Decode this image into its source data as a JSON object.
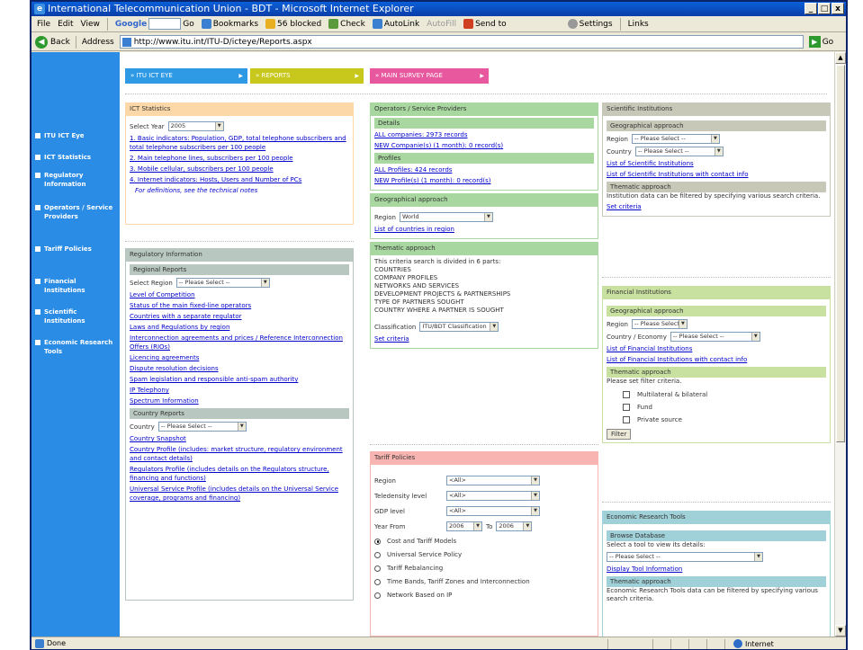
{
  "window": {
    "title": "International Telecommunication Union - BDT - Microsoft Internet Explorer",
    "controls": [
      "_",
      "□",
      "x"
    ]
  },
  "menubar": {
    "items": [
      "File",
      "Edit",
      "View"
    ],
    "google": "Google",
    "go": "Go",
    "bookmarks": "Bookmarks",
    "blocked": "56 blocked",
    "check": "Check",
    "autolink": "AutoLink",
    "autofill": "AutoFill",
    "sendto": "Send to",
    "settings": "Settings",
    "links": "Links"
  },
  "addressbar": {
    "back": "Back",
    "label": "Address",
    "url": "http://www.itu.int/ITU-D/icteye/Reports.aspx",
    "go": "Go"
  },
  "leftnav": [
    "ITU ICT Eye",
    "ICT Statistics",
    "Regulatory Information",
    "Operators / Service Providers",
    "Tariff Policies",
    "Financial Institutions",
    "Scientific Institutions",
    "Economic Research Tools"
  ],
  "tabs": [
    {
      "label": "» ITU ICT EYE",
      "color": "#2e9ae6"
    },
    {
      "label": "» REPORTS",
      "color": "#c8c81c"
    },
    {
      "label": "» MAIN SURVEY PAGE",
      "color": "#e8589e"
    }
  ],
  "ict": {
    "title": "ICT Statistics",
    "select_year_label": "Select Year",
    "year": "2005",
    "links": [
      "1. Basic indicators: Population, GDP, total telephone subscribers and total telephone subscribers per 100 people",
      "2. Main telephone lines, subscribers per 100 people",
      "3. Mobile cellular, subscribers per 100 people",
      "4. Internet indicators: Hosts, Users and Number of PCs"
    ],
    "note": "For definitions, see the technical notes"
  },
  "reg": {
    "title": "Regulatory Information",
    "regional_title": "Regional Reports",
    "select_region_label": "Select Region",
    "region_placeholder": "-- Please Select --",
    "links": [
      "Level of Competition",
      "Status of the main fixed-line operators",
      "Countries with a separate regulator",
      "Laws and Regulations by region",
      "Interconnection agreements and prices / Reference Interconnection Offers (RIOs)",
      "Licencing agreements",
      "Dispute resolution decisions",
      "Spam legislation and responsible anti-spam authority",
      "IP Telephony",
      "Spectrum Information"
    ],
    "country_title": "Country Reports",
    "country_label": "Country",
    "country_placeholder": "-- Please Select --",
    "country_links": [
      "Country Snapshot",
      "Country Profile (includes: market structure, regulatory environment and contact details)",
      "Regulators Profile (includes details on the Regulators structure, financing and functions)",
      "Universal Service Profile (includes details on the Universal Service coverage, programs and financing)"
    ]
  },
  "ops": {
    "title": "Operators / Service Providers",
    "details_title": "Details",
    "details_links": [
      "ALL companies: 2973 records",
      "NEW Companie(s) (1 month): 0 record(s)"
    ],
    "profiles_title": "Profiles",
    "profiles_links": [
      "ALL Profiles: 424 records",
      "NEW Profile(s) (1 month): 0 record(s)"
    ],
    "geo_title": "Geographical approach",
    "region_label": "Region",
    "region_value": "World",
    "countries_link": "List of countries in region",
    "thematic_title": "Thematic approach",
    "thematic_intro": "This criteria search is divided in 6 parts:",
    "parts": [
      "COUNTRIES",
      "COMPANY PROFILES",
      "NETWORKS AND SERVICES",
      "DEVELOPMENT PROJECTS & PARTNERSHIPS",
      "TYPE OF PARTNERS SOUGHT",
      "COUNTRY WHERE A PARTNER IS SOUGHT"
    ],
    "classification_label": "Classification",
    "classification_value": "ITU/BDT Classification",
    "set_criteria": "Set criteria"
  },
  "tariff": {
    "title": "Tariff Policies",
    "fields": [
      {
        "label": "Region",
        "value": "<All>"
      },
      {
        "label": "Teledensity level",
        "value": "<All>"
      },
      {
        "label": "GDP level",
        "value": "<All>"
      }
    ],
    "year_from_label": "Year From",
    "year_from": "2006",
    "to_label": "To",
    "year_to": "2006",
    "options": [
      "Cost and Tariff Models",
      "Universal Service Policy",
      "Tariff Rebalancing",
      "Time Bands, Tariff Zones and Interconnection",
      "Network Based on IP"
    ],
    "selected_option": "Cost and Tariff Models"
  },
  "sci": {
    "title": "Scientific Institutions",
    "geo_title": "Geographical approach",
    "region_label": "Region",
    "region_placeholder": "-- Please Select --",
    "country_label": "Country",
    "country_placeholder": "-- Please Select --",
    "links": [
      "List of Scientific Institutions",
      "List of Scientific Institutions with contact info"
    ],
    "thematic_title": "Thematic approach",
    "thematic_text": "Institution data can be filtered by specifying various search criteria.",
    "set_criteria": "Set criteria"
  },
  "fin": {
    "title": "Financial Institutions",
    "geo_title": "Geographical approach",
    "region_label": "Region",
    "region_placeholder": "-- Please Select --",
    "country_label": "Country / Economy",
    "country_placeholder": "-- Please Select --",
    "links": [
      "List of Financial Institutions",
      "List of Financial Institutions with contact info"
    ],
    "thematic_title": "Thematic approach",
    "thematic_text": "Please set filter criteria.",
    "checkboxes": [
      "Multilateral & bilateral",
      "Fund",
      "Private source"
    ],
    "filter": "Filter"
  },
  "eco": {
    "title": "Economic Research Tools",
    "browse_title": "Browse Database",
    "browse_text": "Select a tool to view its details:",
    "tool_placeholder": "-- Please Select --",
    "display_link": "Display Tool Information",
    "thematic_title": "Thematic approach",
    "thematic_text": "Economic Research Tools data can be filtered by specifying various search criteria."
  },
  "statusbar": {
    "status": "Done",
    "zone": "Internet"
  },
  "colors": {
    "ict": "#fcd8a8",
    "reg": "#b8c8c0",
    "ops": "#a8d8a0",
    "tariff": "#f8b4b0",
    "sci": "#c8c8b8",
    "fin": "#c8e0a0",
    "eco": "#a0d0d8",
    "leftbar": "#2b8ce6"
  }
}
